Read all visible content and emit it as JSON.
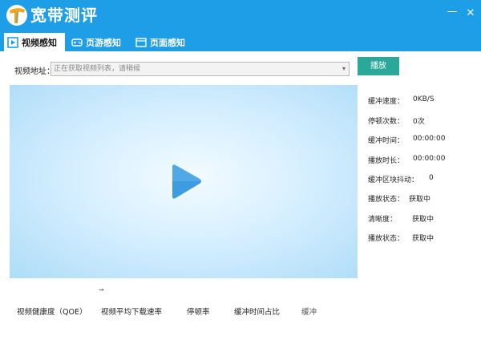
{
  "app": {
    "title": "宽带测评"
  },
  "window": {
    "minimize_glyph": "—",
    "close_glyph": "✕"
  },
  "tabs": [
    {
      "label": "视频感知",
      "icon": "play-box-icon",
      "active": true
    },
    {
      "label": "页游感知",
      "icon": "gamepad-icon",
      "active": false
    },
    {
      "label": "页面感知",
      "icon": "browser-page-icon",
      "active": false
    }
  ],
  "address": {
    "label": "视频地址：",
    "value": "正在获取视频列表，请稍候"
  },
  "play_button": {
    "label": "播放"
  },
  "stats": [
    {
      "label": "缓冲速度：",
      "value": "0KB/S"
    },
    {
      "label": "停顿次数：",
      "value": "0次"
    },
    {
      "label": "缓冲时间：",
      "value": "00:00:00"
    },
    {
      "label": "播放时长：",
      "value": "00:00:00"
    },
    {
      "label": "缓冲区块抖动：",
      "value": "0"
    },
    {
      "label": "播放状态：",
      "value": "获取中"
    },
    {
      "label": "清晰度：",
      "value": "获取中"
    },
    {
      "label": "播放状态：",
      "value": "获取中"
    }
  ],
  "bottom": {
    "arrow": "→",
    "labels": [
      "视频健康度（QOE）",
      "视频平均下载速率",
      "停顿率",
      "缓冲时间占比",
      "缓冲",
      ""
    ]
  },
  "colors": {
    "brand": "#1e9ee6",
    "play_button": "#2aa89a",
    "play_icon": "#3f9be0"
  }
}
